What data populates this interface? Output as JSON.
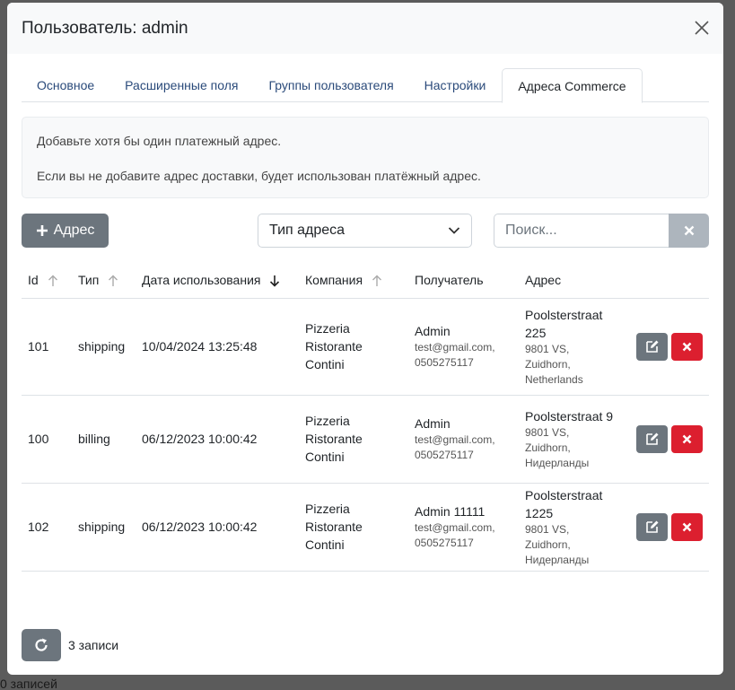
{
  "backdrop": {
    "footer_text": "0 записей"
  },
  "modal": {
    "title": "Пользователь: admin",
    "tabs": [
      {
        "label": "Основное"
      },
      {
        "label": "Расширенные поля"
      },
      {
        "label": "Группы пользователя"
      },
      {
        "label": "Настройки"
      },
      {
        "label": "Адреса Commerce",
        "active": true
      }
    ],
    "info": {
      "line1": "Добавьте хотя бы один платежный адрес.",
      "line2": "Если вы не добавите адрес доставки, будет использован платёжный адрес."
    },
    "toolbar": {
      "add_label": "Адрес",
      "type_select_value": "Тип адреса",
      "search_placeholder": "Поиск..."
    },
    "table": {
      "columns": {
        "id": "Id",
        "type": "Тип",
        "date": "Дата использования",
        "company": "Компания",
        "recipient": "Получатель",
        "address": "Адрес"
      },
      "rows": [
        {
          "id": "101",
          "type": "shipping",
          "date": "10/04/2024 13:25:48",
          "company": [
            "Pizzeria",
            "Ristorante",
            "Contini"
          ],
          "recipient": "Admin",
          "email": "test@gmail.com,",
          "phone": "0505275117",
          "street": [
            "Poolsterstraat",
            "225"
          ],
          "address_sub": [
            "9801 VS,",
            "Zuidhorn,",
            "Netherlands"
          ]
        },
        {
          "id": "100",
          "type": "billing",
          "date": "06/12/2023 10:00:42",
          "company": [
            "Pizzeria",
            "Ristorante",
            "Contini"
          ],
          "recipient": "Admin",
          "email": "test@gmail.com,",
          "phone": "0505275117",
          "street": [
            "Poolsterstraat 9"
          ],
          "address_sub": [
            "9801 VS,",
            "Zuidhorn,",
            "Нидерланды"
          ]
        },
        {
          "id": "102",
          "type": "shipping",
          "date": "06/12/2023 10:00:42",
          "company": [
            "Pizzeria",
            "Ristorante",
            "Contini"
          ],
          "recipient": "Admin 11111",
          "email": "test@gmail.com,",
          "phone": "0505275117",
          "street": [
            "Poolsterstraat",
            "1225"
          ],
          "address_sub": [
            "9801 VS,",
            "Zuidhorn,",
            "Нидерланды"
          ]
        }
      ]
    },
    "footer": {
      "count_label": "3 записи"
    }
  },
  "colors": {
    "secondary": "#6c757d",
    "danger": "#dc1f2f",
    "tab_link": "#2a4a7a",
    "overlay": "#5b5b5b"
  },
  "icons": {
    "close": "close-icon",
    "add": "plus-icon",
    "select": "chevron-down-icon",
    "clear": "x-icon",
    "sort_asc": "arrow-up-icon",
    "sort_desc": "arrow-down-icon",
    "edit": "edit-icon",
    "delete": "x-icon",
    "refresh": "refresh-icon"
  }
}
